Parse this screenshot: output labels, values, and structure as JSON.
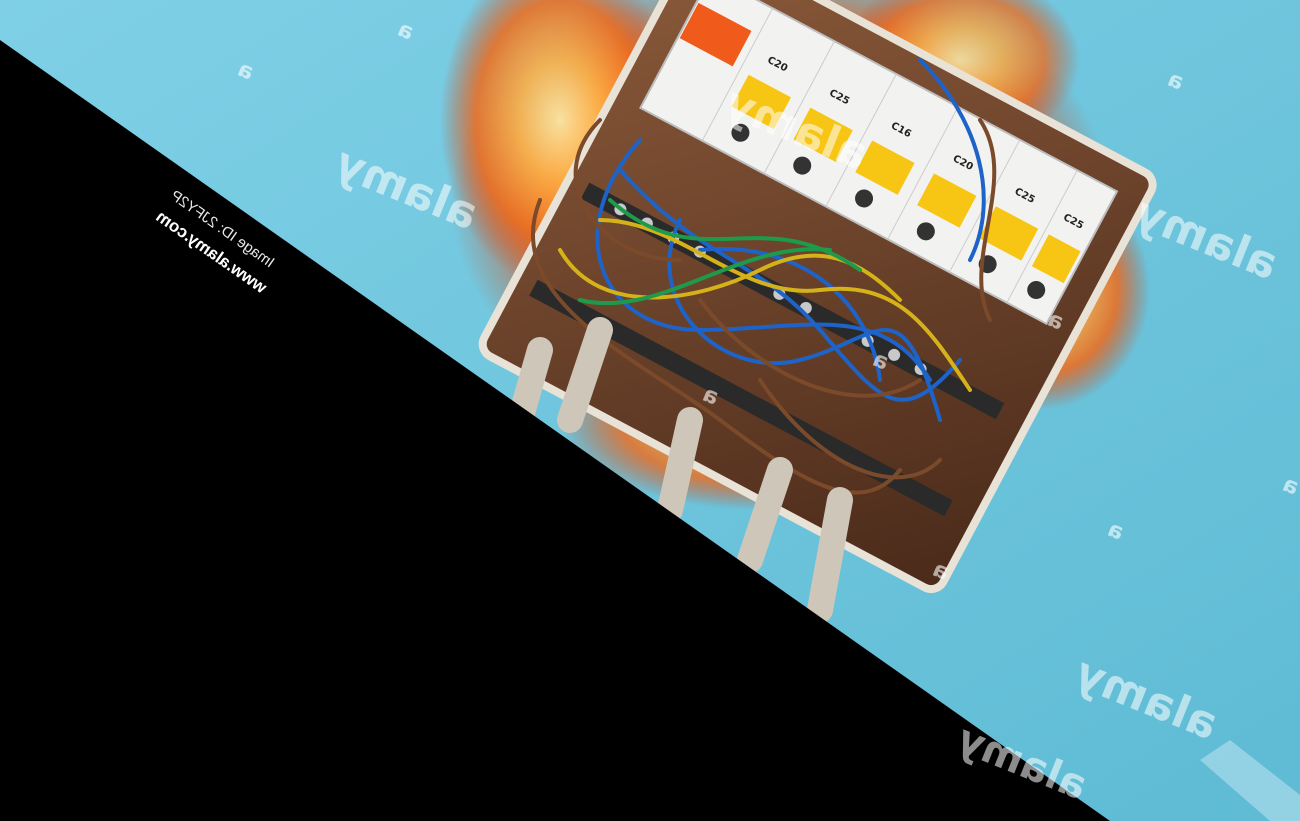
{
  "image": {
    "subject": "burning electrical breaker panel",
    "background_color": "#6cc5dc",
    "mask_color": "#000000"
  },
  "credits": {
    "image_id": "Image ID: 2JFY2P",
    "url": "www.alamy.com"
  },
  "watermark": {
    "brand": "alamy",
    "glyph": "a"
  },
  "breakers": {
    "labels": [
      "C20",
      "C25",
      "C16",
      "C20",
      "C25",
      "C25"
    ]
  }
}
